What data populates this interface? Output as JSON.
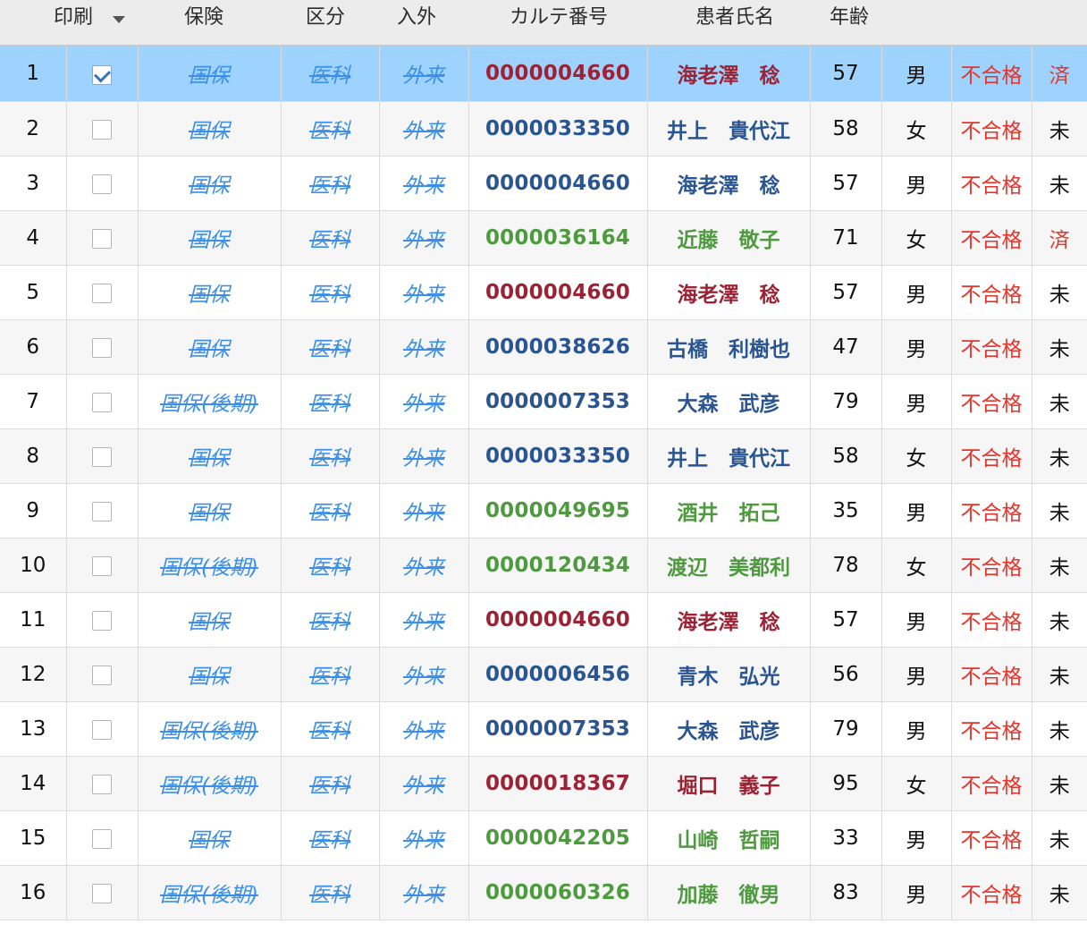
{
  "header": {
    "print": "印刷",
    "insurance": "保険",
    "division": "区分",
    "inout": "入外",
    "chart_no": "カルテ番号",
    "patient_name": "患者氏名",
    "age": "年齢"
  },
  "rows": [
    {
      "no": "1",
      "checked": true,
      "insurance": "国保",
      "division": "医科",
      "inout": "外来",
      "chart_no": "0000004660",
      "name": "海老澤　稔",
      "age": "57",
      "sex": "男",
      "result": "不合格",
      "status": "済",
      "name_color": "red",
      "selected": true
    },
    {
      "no": "2",
      "checked": false,
      "insurance": "国保",
      "division": "医科",
      "inout": "外来",
      "chart_no": "0000033350",
      "name": "井上　貴代江",
      "age": "58",
      "sex": "女",
      "result": "不合格",
      "status": "未",
      "name_color": "blue",
      "selected": false
    },
    {
      "no": "3",
      "checked": false,
      "insurance": "国保",
      "division": "医科",
      "inout": "外来",
      "chart_no": "0000004660",
      "name": "海老澤　稔",
      "age": "57",
      "sex": "男",
      "result": "不合格",
      "status": "未",
      "name_color": "blue",
      "selected": false
    },
    {
      "no": "4",
      "checked": false,
      "insurance": "国保",
      "division": "医科",
      "inout": "外来",
      "chart_no": "0000036164",
      "name": "近藤　敬子",
      "age": "71",
      "sex": "女",
      "result": "不合格",
      "status": "済",
      "name_color": "green",
      "selected": false
    },
    {
      "no": "5",
      "checked": false,
      "insurance": "国保",
      "division": "医科",
      "inout": "外来",
      "chart_no": "0000004660",
      "name": "海老澤　稔",
      "age": "57",
      "sex": "男",
      "result": "不合格",
      "status": "未",
      "name_color": "red",
      "selected": false
    },
    {
      "no": "6",
      "checked": false,
      "insurance": "国保",
      "division": "医科",
      "inout": "外来",
      "chart_no": "0000038626",
      "name": "古橋　利樹也",
      "age": "47",
      "sex": "男",
      "result": "不合格",
      "status": "未",
      "name_color": "blue",
      "selected": false
    },
    {
      "no": "7",
      "checked": false,
      "insurance": "国保(後期)",
      "division": "医科",
      "inout": "外来",
      "chart_no": "0000007353",
      "name": "大森　武彦",
      "age": "79",
      "sex": "男",
      "result": "不合格",
      "status": "未",
      "name_color": "blue",
      "selected": false
    },
    {
      "no": "8",
      "checked": false,
      "insurance": "国保",
      "division": "医科",
      "inout": "外来",
      "chart_no": "0000033350",
      "name": "井上　貴代江",
      "age": "58",
      "sex": "女",
      "result": "不合格",
      "status": "未",
      "name_color": "blue",
      "selected": false
    },
    {
      "no": "9",
      "checked": false,
      "insurance": "国保",
      "division": "医科",
      "inout": "外来",
      "chart_no": "0000049695",
      "name": "酒井　拓己",
      "age": "35",
      "sex": "男",
      "result": "不合格",
      "status": "未",
      "name_color": "green",
      "selected": false
    },
    {
      "no": "10",
      "checked": false,
      "insurance": "国保(後期)",
      "division": "医科",
      "inout": "外来",
      "chart_no": "0000120434",
      "name": "渡辺　美都利",
      "age": "78",
      "sex": "女",
      "result": "不合格",
      "status": "未",
      "name_color": "green",
      "selected": false
    },
    {
      "no": "11",
      "checked": false,
      "insurance": "国保",
      "division": "医科",
      "inout": "外来",
      "chart_no": "0000004660",
      "name": "海老澤　稔",
      "age": "57",
      "sex": "男",
      "result": "不合格",
      "status": "未",
      "name_color": "red",
      "selected": false
    },
    {
      "no": "12",
      "checked": false,
      "insurance": "国保",
      "division": "医科",
      "inout": "外来",
      "chart_no": "0000006456",
      "name": "青木　弘光",
      "age": "56",
      "sex": "男",
      "result": "不合格",
      "status": "未",
      "name_color": "blue",
      "selected": false
    },
    {
      "no": "13",
      "checked": false,
      "insurance": "国保(後期)",
      "division": "医科",
      "inout": "外来",
      "chart_no": "0000007353",
      "name": "大森　武彦",
      "age": "79",
      "sex": "男",
      "result": "不合格",
      "status": "未",
      "name_color": "blue",
      "selected": false
    },
    {
      "no": "14",
      "checked": false,
      "insurance": "国保(後期)",
      "division": "医科",
      "inout": "外来",
      "chart_no": "0000018367",
      "name": "堀口　義子",
      "age": "95",
      "sex": "女",
      "result": "不合格",
      "status": "未",
      "name_color": "red",
      "selected": false
    },
    {
      "no": "15",
      "checked": false,
      "insurance": "国保",
      "division": "医科",
      "inout": "外来",
      "chart_no": "0000042205",
      "name": "山崎　哲嗣",
      "age": "33",
      "sex": "男",
      "result": "不合格",
      "status": "未",
      "name_color": "green",
      "selected": false
    },
    {
      "no": "16",
      "checked": false,
      "insurance": "国保(後期)",
      "division": "医科",
      "inout": "外来",
      "chart_no": "0000060326",
      "name": "加藤　徹男",
      "age": "83",
      "sex": "男",
      "result": "不合格",
      "status": "未",
      "name_color": "green",
      "selected": false
    }
  ],
  "colors": {
    "selected_row": "#9fd3ff",
    "red_text": "#9b2335",
    "blue_text": "#2a5591",
    "green_text": "#4e9a3f",
    "insurance_link": "#3b8fe6",
    "fail_text": "#e8332a"
  },
  "icons": {
    "sort": "chevron-down-icon",
    "checkbox": "checkbox-icon"
  }
}
